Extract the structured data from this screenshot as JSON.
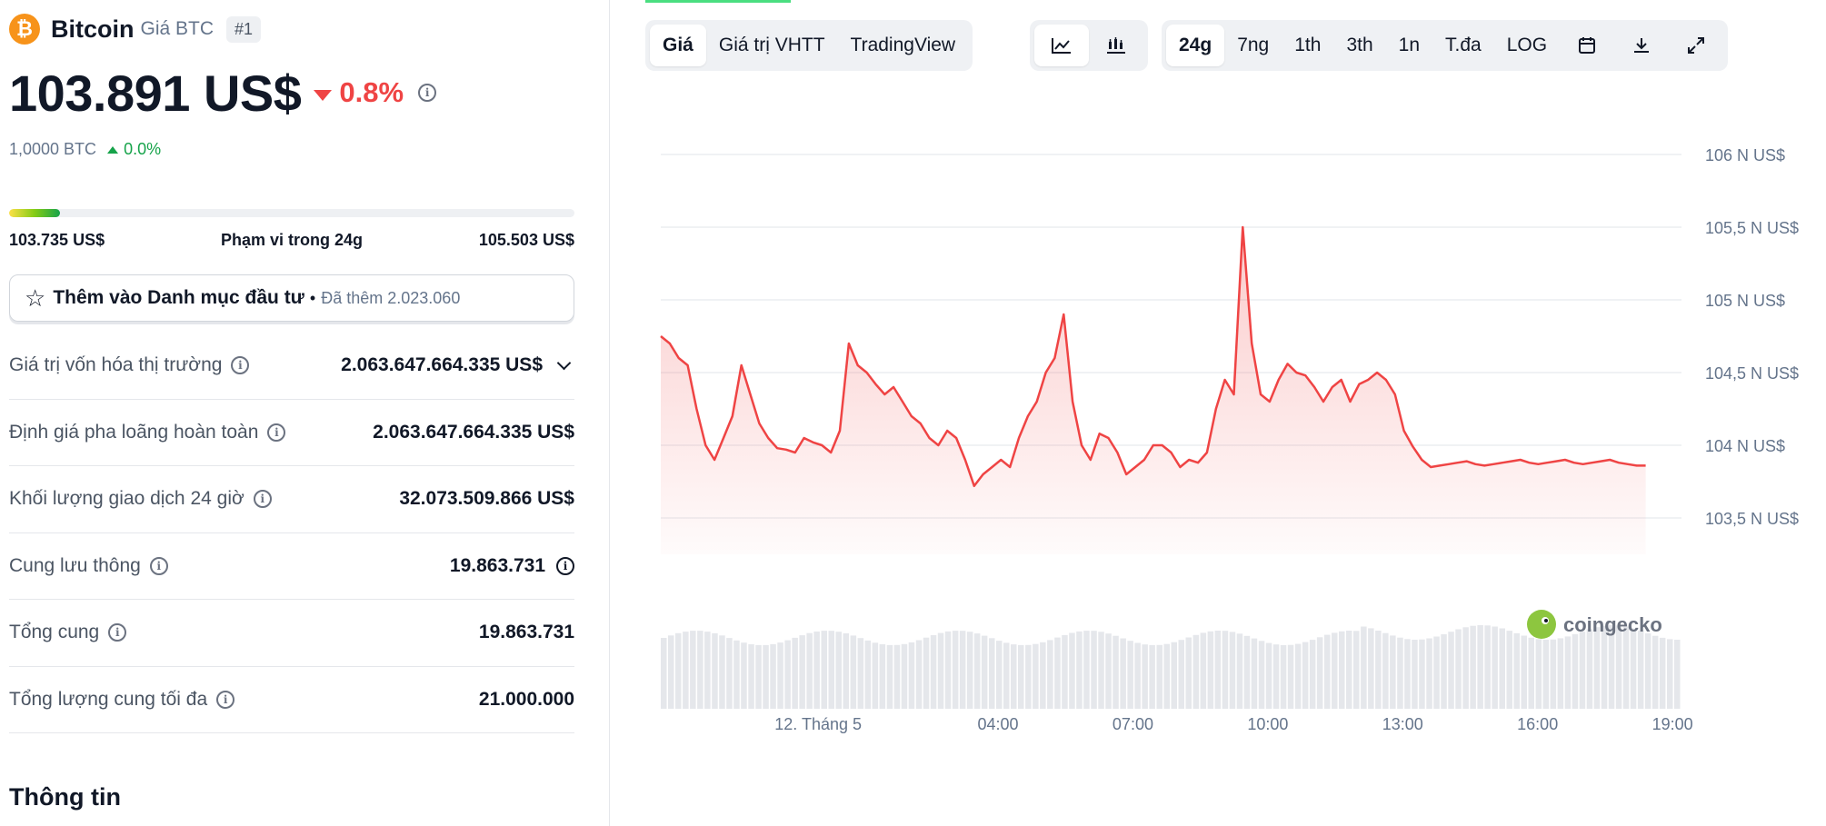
{
  "coin": {
    "logo_symbol": "₿",
    "name": "Bitcoin",
    "subtitle": "Giá BTC",
    "rank": "#1",
    "price": "103.891 US$",
    "change_pct": "0.8%",
    "btc_value": "1,0000 BTC",
    "btc_change": "0.0%"
  },
  "range_24h": {
    "low": "103.735 US$",
    "label": "Phạm vi trong 24g",
    "high": "105.503 US$",
    "position_fraction": 0.09
  },
  "watchlist": {
    "label": "Thêm vào Danh mục đầu tư",
    "separator": "•",
    "added_text": "Đã thêm 2.023.060"
  },
  "stats": [
    {
      "label": "Giá trị vốn hóa thị trường",
      "value": "2.063.647.664.335 US$"
    },
    {
      "label": "Định giá pha loãng hoàn toàn",
      "value": "2.063.647.664.335 US$"
    },
    {
      "label": "Khối lượng giao dịch 24 giờ",
      "value": "32.073.509.866 US$"
    },
    {
      "label": "Cung lưu thông",
      "value": "19.863.731"
    },
    {
      "label": "Tổng cung",
      "value": "19.863.731"
    },
    {
      "label": "Tổng lượng cung tối đa",
      "value": "21.000.000"
    }
  ],
  "info_title": "Thông tin",
  "tabs": {
    "view": [
      "Giá",
      "Giá trị VHTT",
      "TradingView"
    ],
    "chart_type_icons": [
      "line-chart-icon",
      "candlestick-icon"
    ],
    "ranges": [
      "24g",
      "7ng",
      "1th",
      "3th",
      "1n",
      "T.đa",
      "LOG"
    ],
    "tool_icons": [
      "calendar-icon",
      "download-icon",
      "expand-icon"
    ]
  },
  "colors": {
    "accent_red": "#ef4444",
    "accent_green": "#16a34a",
    "btc_orange": "#f7931a"
  },
  "watermark": "coingecko",
  "chart_data": {
    "type": "area",
    "ylabel_ticks": [
      "106 N US$",
      "105,5 N US$",
      "105 N US$",
      "104,5 N US$",
      "104 N US$",
      "103,5 N US$"
    ],
    "y_tick_values": [
      106000,
      105500,
      105000,
      104500,
      104000,
      103500
    ],
    "ylim": [
      103500,
      106000
    ],
    "x_tick_labels": [
      "12. Tháng 5",
      "04:00",
      "07:00",
      "10:00",
      "13:00",
      "16:00",
      "19:00"
    ],
    "x_tick_hours": [
      0,
      4,
      7,
      10,
      13,
      16,
      19
    ],
    "x_range_hours": [
      -3.5,
      19.2
    ],
    "grid": true,
    "series": [
      {
        "color": "#ef4444",
        "x_hours": [
          -3.5,
          -3.3,
          -3.1,
          -2.9,
          -2.7,
          -2.5,
          -2.3,
          -2.1,
          -1.9,
          -1.7,
          -1.5,
          -1.3,
          -1.1,
          -0.9,
          -0.7,
          -0.5,
          -0.3,
          -0.1,
          0.1,
          0.3,
          0.5,
          0.7,
          0.9,
          1.1,
          1.3,
          1.5,
          1.7,
          1.9,
          2.1,
          2.3,
          2.5,
          2.7,
          2.9,
          3.1,
          3.3,
          3.5,
          3.7,
          3.9,
          4.1,
          4.3,
          4.5,
          4.7,
          4.9,
          5.1,
          5.3,
          5.5,
          5.7,
          5.9,
          6.1,
          6.3,
          6.5,
          6.7,
          6.9,
          7.1,
          7.3,
          7.5,
          7.7,
          7.9,
          8.1,
          8.3,
          8.5,
          8.7,
          8.9,
          9.1,
          9.3,
          9.5,
          9.7,
          9.9,
          10.1,
          10.3,
          10.5,
          10.7,
          10.9,
          11.1,
          11.3,
          11.5,
          11.7,
          11.9,
          12.1,
          12.3,
          12.5,
          12.7,
          12.9,
          13.1,
          13.3,
          13.5,
          13.7,
          13.9,
          14.1,
          14.3,
          14.5,
          14.7,
          14.9,
          15.1,
          15.3,
          15.5,
          15.7,
          15.9,
          16.1,
          16.3,
          16.5,
          16.7,
          16.9,
          17.1,
          17.3,
          17.5,
          17.7,
          17.9,
          18.1,
          18.3,
          18.5,
          18.7,
          18.9,
          19.1,
          19.2
        ],
        "values": [
          104750,
          104700,
          104600,
          104550,
          104250,
          104000,
          103900,
          104050,
          104200,
          104550,
          104350,
          104150,
          104050,
          103980,
          103970,
          103950,
          104050,
          104020,
          104000,
          103950,
          104100,
          104700,
          104550,
          104500,
          104420,
          104350,
          104400,
          104300,
          104200,
          104150,
          104050,
          104000,
          104100,
          104050,
          103900,
          103720,
          103800,
          103850,
          103900,
          103850,
          104050,
          104200,
          104300,
          104500,
          104600,
          104900,
          104300,
          104000,
          103900,
          104080,
          104050,
          103950,
          103800,
          103850,
          103900,
          104000,
          104000,
          103950,
          103850,
          103900,
          103880,
          103950,
          104250,
          104450,
          104350,
          105500,
          104700,
          104350,
          104300,
          104450,
          104560,
          104500,
          104480,
          104400,
          104300,
          104400,
          104450,
          104300,
          104420,
          104450,
          104500,
          104450,
          104350,
          104100,
          103990,
          103900,
          103850,
          103860,
          103870,
          103880,
          103890,
          103870,
          103860,
          103870,
          103880,
          103890,
          103900,
          103880,
          103870,
          103880,
          103890,
          103900,
          103880,
          103870,
          103880,
          103890,
          103900,
          103880,
          103870,
          103860,
          103860
        ]
      }
    ],
    "volume_bars_present": true
  }
}
